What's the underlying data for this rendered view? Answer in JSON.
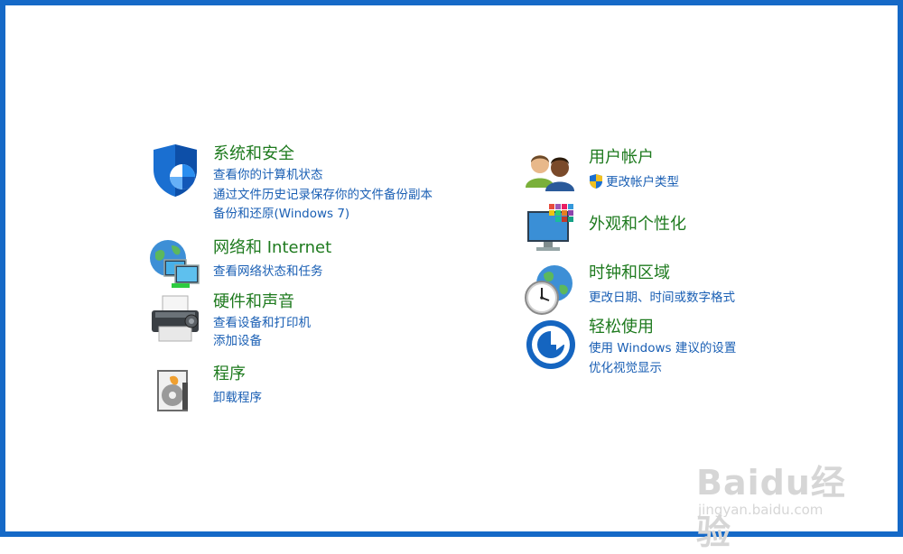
{
  "categories_left": [
    {
      "title": "系统和安全",
      "links": [
        "查看你的计算机状态",
        "通过文件历史记录保存你的文件备份副本",
        "备份和还原(Windows 7)"
      ],
      "icon": "security-shield-icon"
    },
    {
      "title": "网络和 Internet",
      "links": [
        "查看网络状态和任务"
      ],
      "icon": "network-globe-icon"
    },
    {
      "title": "硬件和声音",
      "links": [
        "查看设备和打印机",
        "添加设备"
      ],
      "icon": "printer-icon"
    },
    {
      "title": "程序",
      "links": [
        "卸载程序"
      ],
      "icon": "programs-box-icon"
    }
  ],
  "categories_right": [
    {
      "title": "用户帐户",
      "links": [
        "更改帐户类型"
      ],
      "icon": "users-icon",
      "link_icon": "uac-shield-icon"
    },
    {
      "title": "外观和个性化",
      "links": [],
      "icon": "monitor-palette-icon"
    },
    {
      "title": "时钟和区域",
      "links": [
        "更改日期、时间或数字格式"
      ],
      "icon": "clock-globe-icon"
    },
    {
      "title": "轻松使用",
      "links": [
        "使用 Windows 建议的设置",
        "优化视觉显示"
      ],
      "icon": "ease-of-access-icon"
    }
  ],
  "watermark": {
    "logo": "Baidu经验",
    "url": "jingyan.baidu.com"
  },
  "colors": {
    "border": "#1569c7",
    "title": "#1e7a1e",
    "link": "#1a5fb4"
  }
}
